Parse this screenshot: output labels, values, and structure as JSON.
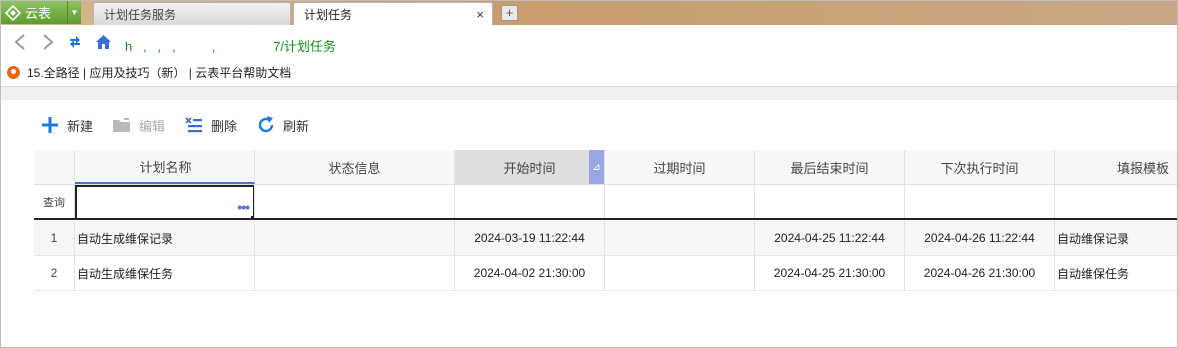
{
  "browser": {
    "app_button_label": "云表",
    "tabs": [
      {
        "title": "计划任务服务",
        "active": false
      },
      {
        "title": "计划任务",
        "active": true
      }
    ],
    "close_glyph": "×",
    "new_tab_glyph": "+",
    "url": "h   ,   ,   ,          ,                7/计划任务",
    "bookmarks_text": "15.全路径 | 应用及技巧（新） | 云表平台帮助文档"
  },
  "toolbar": {
    "new_label": "新建",
    "edit_label": "编辑",
    "delete_label": "删除",
    "refresh_label": "刷新"
  },
  "grid": {
    "query_label": "查询",
    "sort_indicator": "⊿",
    "columns": [
      "计划名称",
      "状态信息",
      "开始时间",
      "过期时间",
      "最后结束时间",
      "下次执行时间",
      "填报模板"
    ],
    "rows": [
      {
        "index": "1",
        "name": "自动生成维保记录",
        "status": "",
        "start": "2024-03-19 11:22:44",
        "expire": "",
        "last_end": "2024-04-25 11:22:44",
        "next_run": "2024-04-26 11:22:44",
        "template": "自动维保记录"
      },
      {
        "index": "2",
        "name": "自动生成维保任务",
        "status": "",
        "start": "2024-04-02 21:30:00",
        "expire": "",
        "last_end": "2024-04-25 21:30:00",
        "next_run": "2024-04-26 21:30:00",
        "template": "自动维保任务"
      }
    ]
  },
  "colors": {
    "app_green": "#6aa83a",
    "accent_blue": "#1e7ad6",
    "sort_purple": "#9aa6e4",
    "url_green": "#1a8f1a"
  }
}
